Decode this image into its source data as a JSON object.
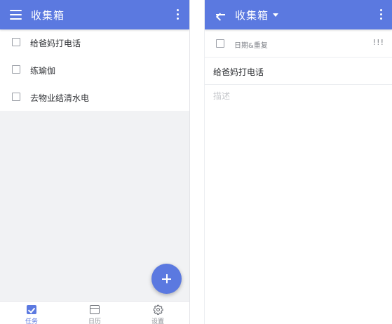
{
  "colors": {
    "accent": "#5b79e0",
    "list_bg": "#f1f2f4",
    "text_primary": "#303236",
    "text_secondary": "#7c7f86",
    "placeholder": "#c7c9cd"
  },
  "left_screen": {
    "appbar": {
      "title": "收集箱",
      "menu_icon": "menu-icon",
      "more_icon": "more-vert-icon"
    },
    "tasks": [
      {
        "label": "给爸妈打电话",
        "checked": false
      },
      {
        "label": "练瑜伽",
        "checked": false
      },
      {
        "label": "去物业结清水电",
        "checked": false
      }
    ],
    "fab": {
      "icon": "plus-icon"
    },
    "bottom_nav": [
      {
        "label": "任务",
        "icon": "tasks-check-icon",
        "active": true
      },
      {
        "label": "日历",
        "icon": "calendar-icon",
        "active": false
      },
      {
        "label": "设置",
        "icon": "gear-icon",
        "active": false
      }
    ]
  },
  "right_screen": {
    "appbar": {
      "title": "收集箱",
      "back_icon": "arrow-back-icon",
      "dropdown_icon": "caret-down-icon",
      "more_icon": "more-vert-icon"
    },
    "meta": {
      "date_repeat": "日期&重复",
      "priority": "!!!"
    },
    "task_title": "给爸妈打电话",
    "description_placeholder": "描述"
  }
}
